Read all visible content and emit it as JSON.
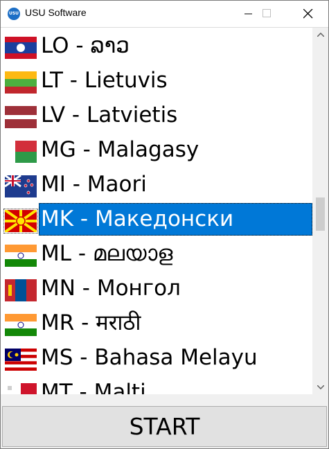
{
  "window": {
    "title": "USU Software",
    "icon_text": "USU"
  },
  "languages": [
    {
      "code_label": "LO - ລາວ",
      "flag": "laos-flag-icon"
    },
    {
      "code_label": "LT - Lietuvis",
      "flag": "lithuania-flag-icon"
    },
    {
      "code_label": "LV - Latvietis",
      "flag": "latvia-flag-icon"
    },
    {
      "code_label": "MG - Malagasy",
      "flag": "madagascar-flag-icon"
    },
    {
      "code_label": "MI - Maori",
      "flag": "new-zealand-flag-icon"
    },
    {
      "code_label": "MK - Македонски",
      "flag": "north-macedonia-flag-icon",
      "selected": true
    },
    {
      "code_label": "ML - മലയാള",
      "flag": "india-flag-icon"
    },
    {
      "code_label": "MN - Монгол",
      "flag": "mongolia-flag-icon"
    },
    {
      "code_label": "MR - मराठी",
      "flag": "india-flag-icon"
    },
    {
      "code_label": "MS - Bahasa Melayu",
      "flag": "malaysia-flag-icon"
    },
    {
      "code_label": "MT - Malti",
      "flag": "malta-flag-icon"
    }
  ],
  "start_button": {
    "label": "START"
  },
  "colors": {
    "selection": "#0078d7",
    "background": "#f0f0f0",
    "button": "#e1e1e1"
  }
}
